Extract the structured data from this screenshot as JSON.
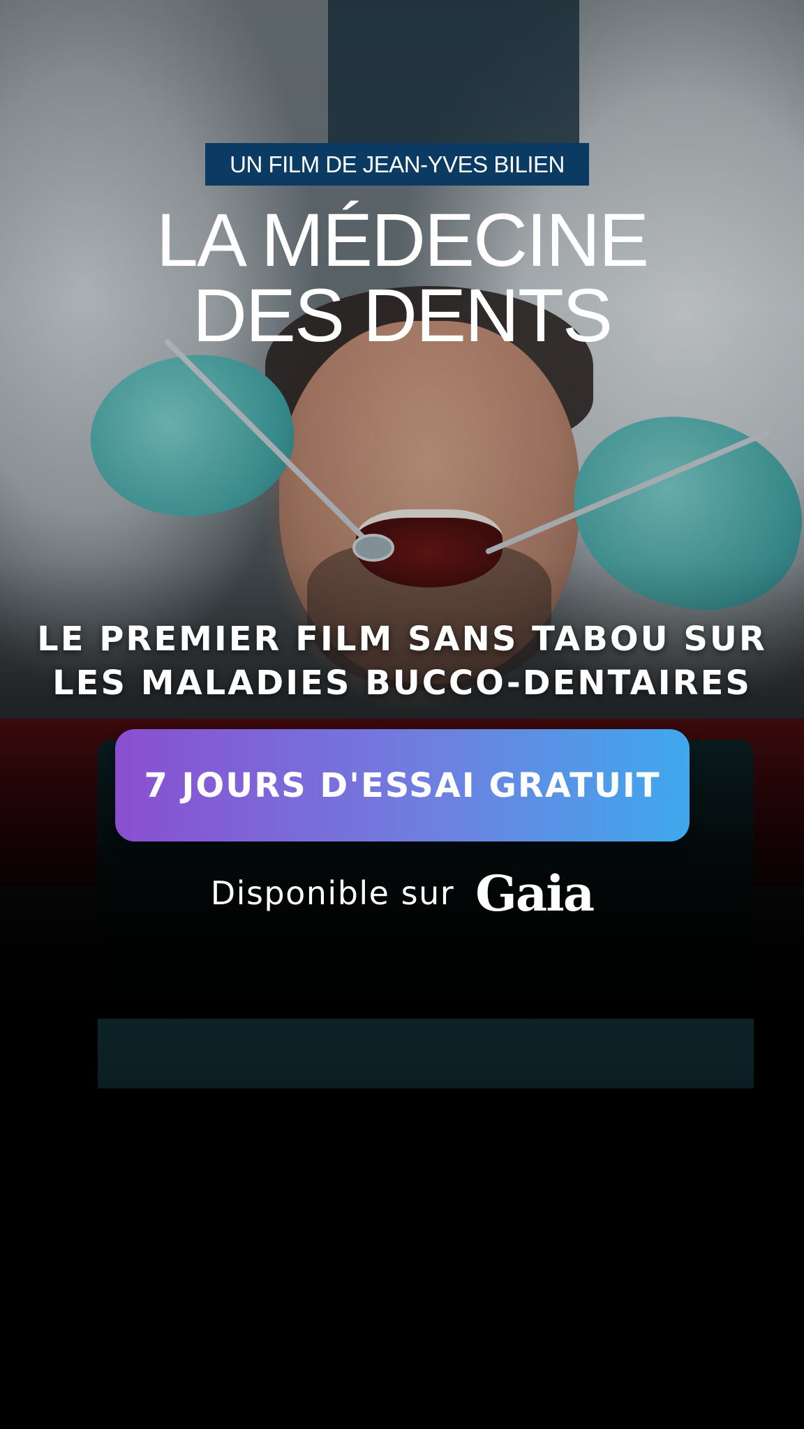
{
  "credit": "UN FILM DE JEAN-YVES BILIEN",
  "title": {
    "line1": "LA MÉDECINE",
    "line2": "DES DENTS"
  },
  "tagline": {
    "line1": "LE PREMIER FILM SANS TABOU SUR",
    "line2": "LES MALADIES BUCCO-DENTAIRES"
  },
  "cta": {
    "label": "7 JOURS D'ESSAI GRATUIT"
  },
  "availability": {
    "label": "Disponible sur",
    "brand": "Gaia"
  },
  "colors": {
    "credit_bg": "#0b3a63",
    "cta_gradient_start": "#8a4fd0",
    "cta_gradient_end": "#3fa8ec",
    "background": "#000000",
    "glove": "#5fc0c0"
  }
}
